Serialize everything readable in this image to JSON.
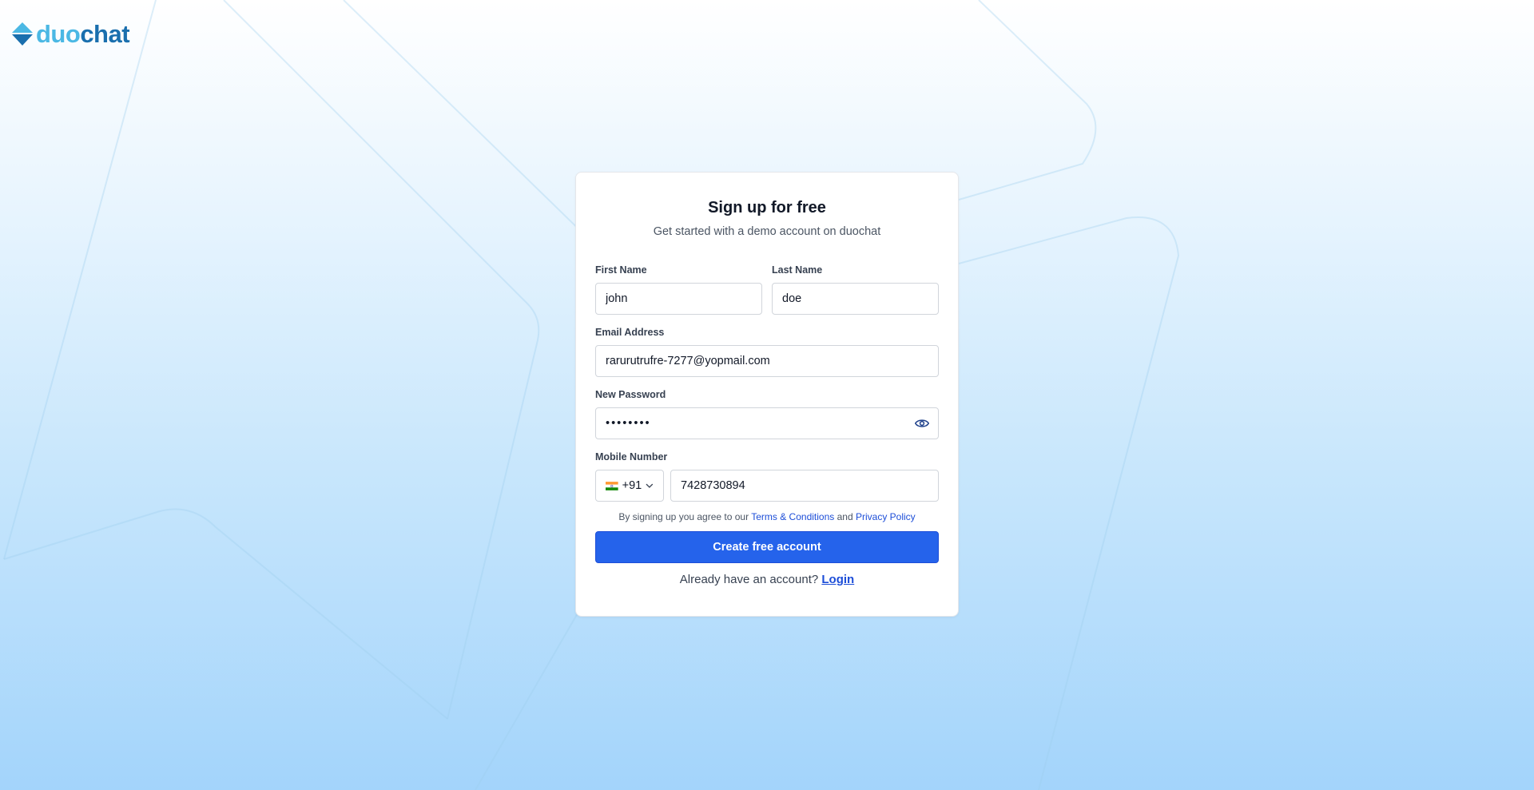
{
  "brand": {
    "logo_part1": "duo",
    "logo_part2": "chat"
  },
  "form": {
    "title": "Sign up for free",
    "subtitle": "Get started with a demo account on duochat",
    "first_name": {
      "label": "First Name",
      "value": "john"
    },
    "last_name": {
      "label": "Last Name",
      "value": "doe"
    },
    "email": {
      "label": "Email Address",
      "value": "rarurutrufre-7277@yopmail.com"
    },
    "password": {
      "label": "New Password",
      "value": "••••••••"
    },
    "mobile": {
      "label": "Mobile Number",
      "country_code": "+91",
      "value": "7428730894"
    },
    "terms": {
      "prefix": "By signing up you agree to our",
      "terms_link": "Terms & Conditions",
      "conjunction": "and",
      "privacy_link": "Privacy Policy"
    },
    "submit_label": "Create free account",
    "login_prompt": "Already have an account?",
    "login_link": "Login"
  },
  "colors": {
    "primary": "#2563eb",
    "link": "#1d4ed8",
    "logo_light": "#4bb8e4",
    "logo_dark": "#1a6fae"
  }
}
